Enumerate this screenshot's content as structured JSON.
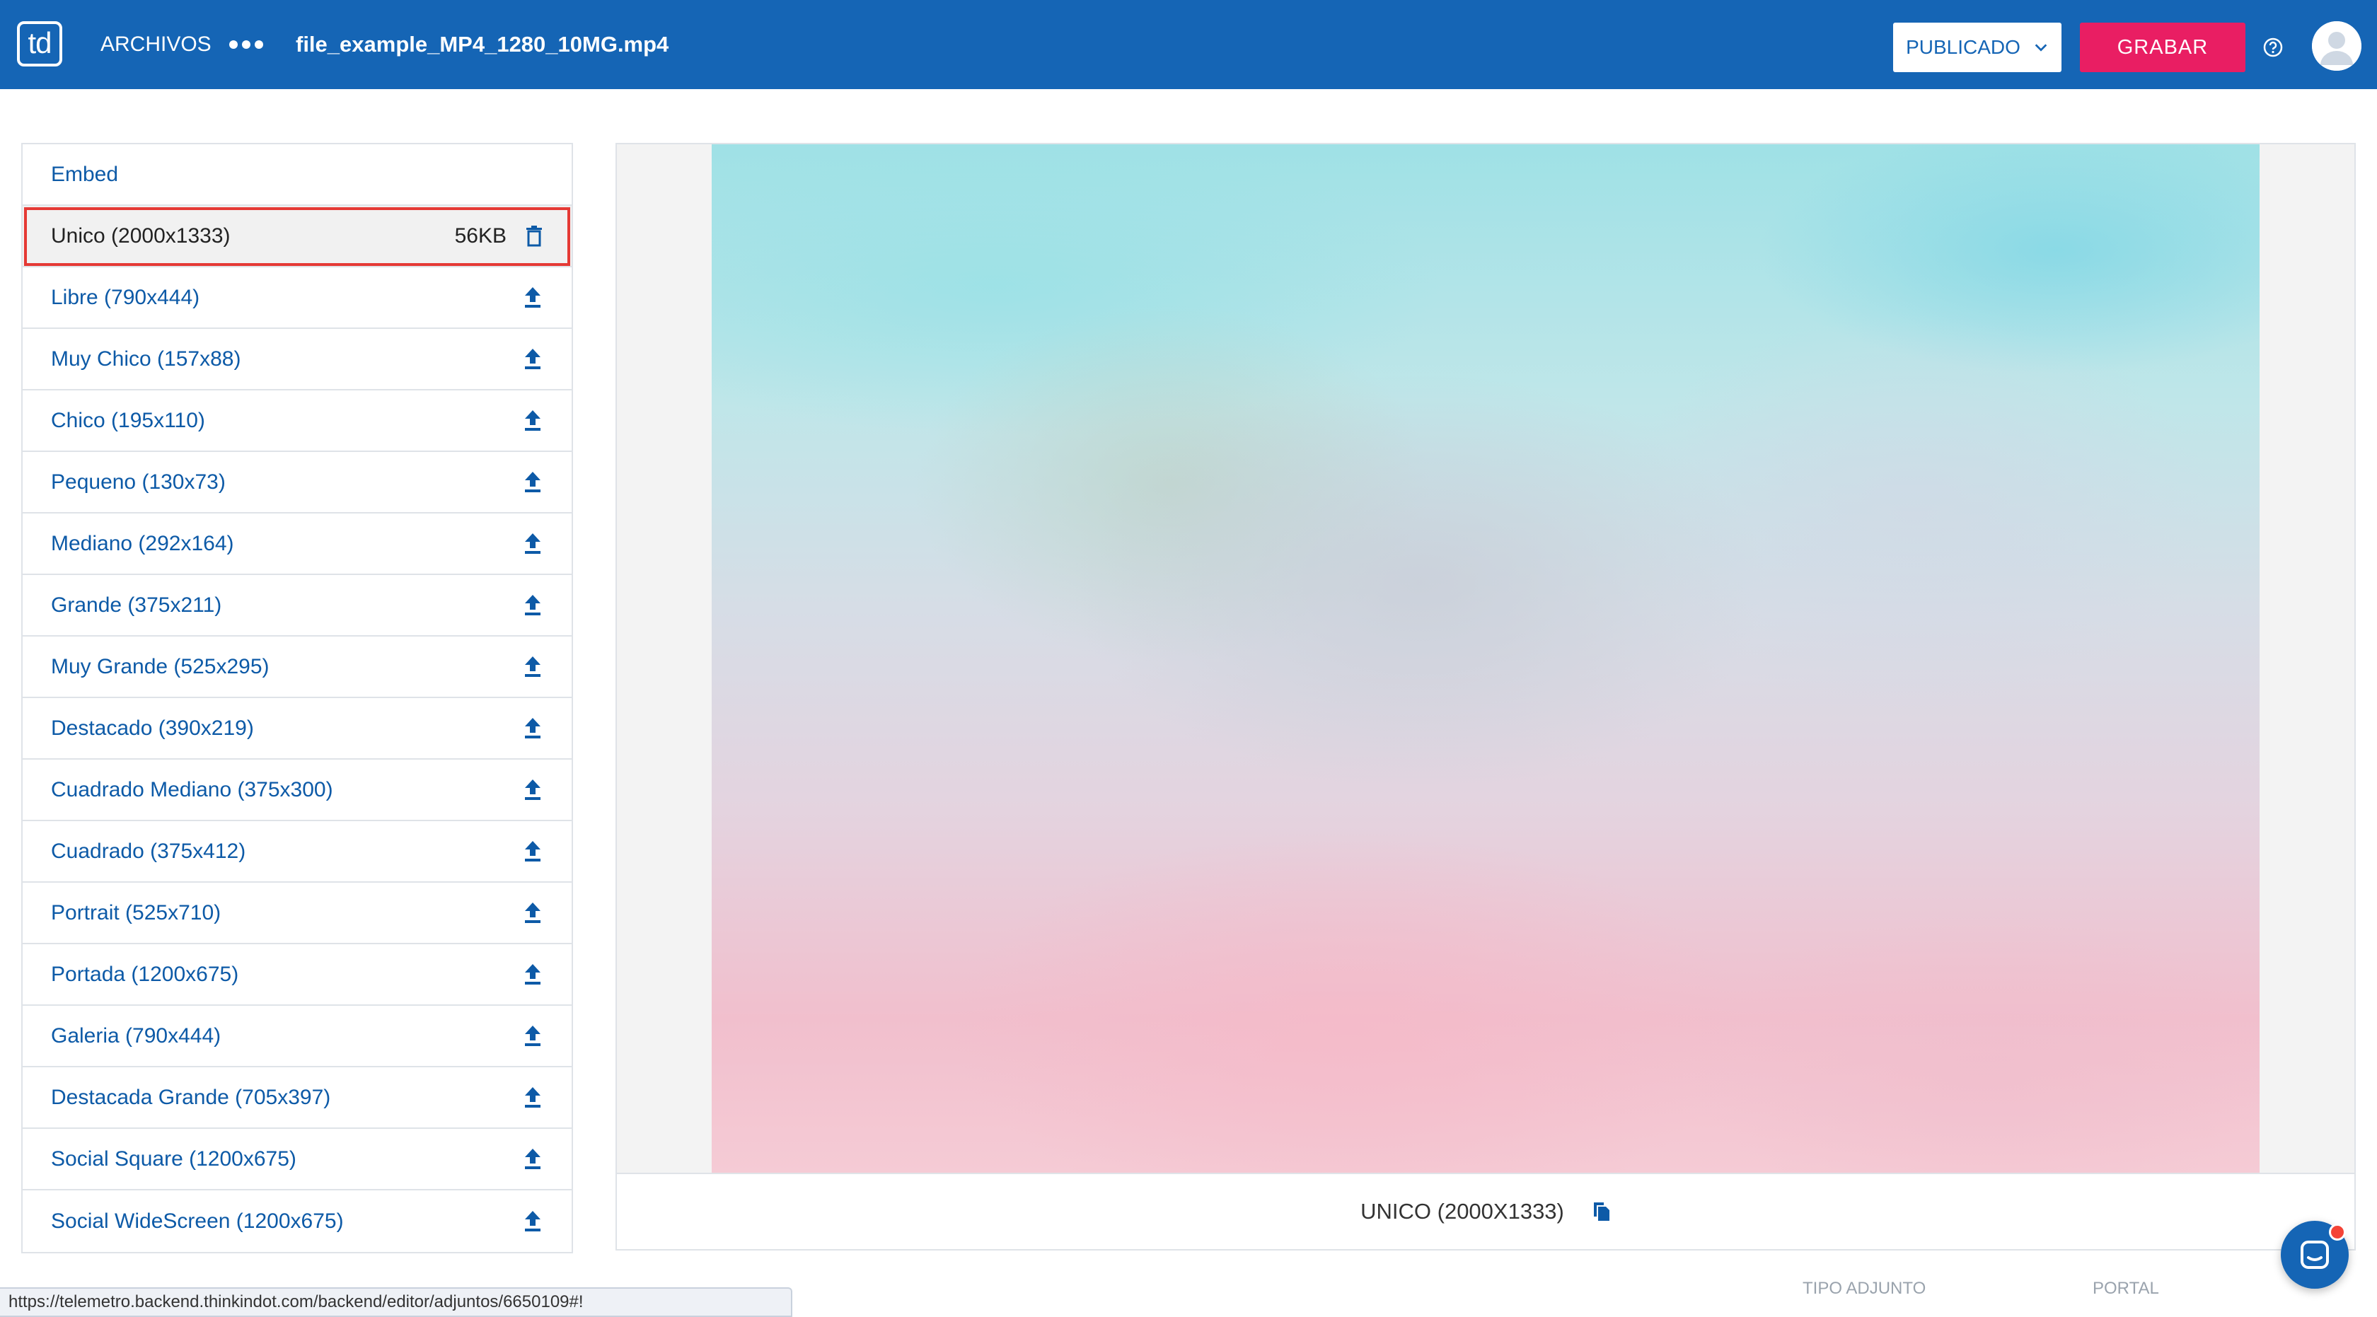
{
  "header": {
    "logo_text": "td",
    "section": "ARCHIVOS",
    "filename": "file_example_MP4_1280_10MG.mp4",
    "status_value": "PUBLICADO",
    "save_label": "GRABAR"
  },
  "sidebar": {
    "embed_label": "Embed",
    "selected": {
      "label": "Unico (2000x1333)",
      "size": "56KB"
    },
    "items": [
      {
        "label": "Libre (790x444)"
      },
      {
        "label": "Muy Chico (157x88)"
      },
      {
        "label": "Chico (195x110)"
      },
      {
        "label": "Pequeno (130x73)"
      },
      {
        "label": "Mediano (292x164)"
      },
      {
        "label": "Grande (375x211)"
      },
      {
        "label": "Muy Grande (525x295)"
      },
      {
        "label": "Destacado (390x219)"
      },
      {
        "label": "Cuadrado Mediano (375x300)"
      },
      {
        "label": "Cuadrado (375x412)"
      },
      {
        "label": "Portrait (525x710)"
      },
      {
        "label": "Portada (1200x675)"
      },
      {
        "label": "Galeria (790x444)"
      },
      {
        "label": "Destacada Grande (705x397)"
      },
      {
        "label": "Social Square (1200x675)"
      },
      {
        "label": "Social WideScreen (1200x675)"
      }
    ]
  },
  "preview": {
    "caption": "UNICO (2000X1333)"
  },
  "footer": {
    "col_tipo": "TIPO ADJUNTO",
    "col_portal": "PORTAL",
    "status_url": "https://telemetro.backend.thinkindot.com/backend/editor/adjuntos/6650109#!"
  },
  "colors": {
    "brand": "#1565b5",
    "accent": "#e91e63",
    "link": "#0d5aa7",
    "selection_outline": "#e53935"
  }
}
